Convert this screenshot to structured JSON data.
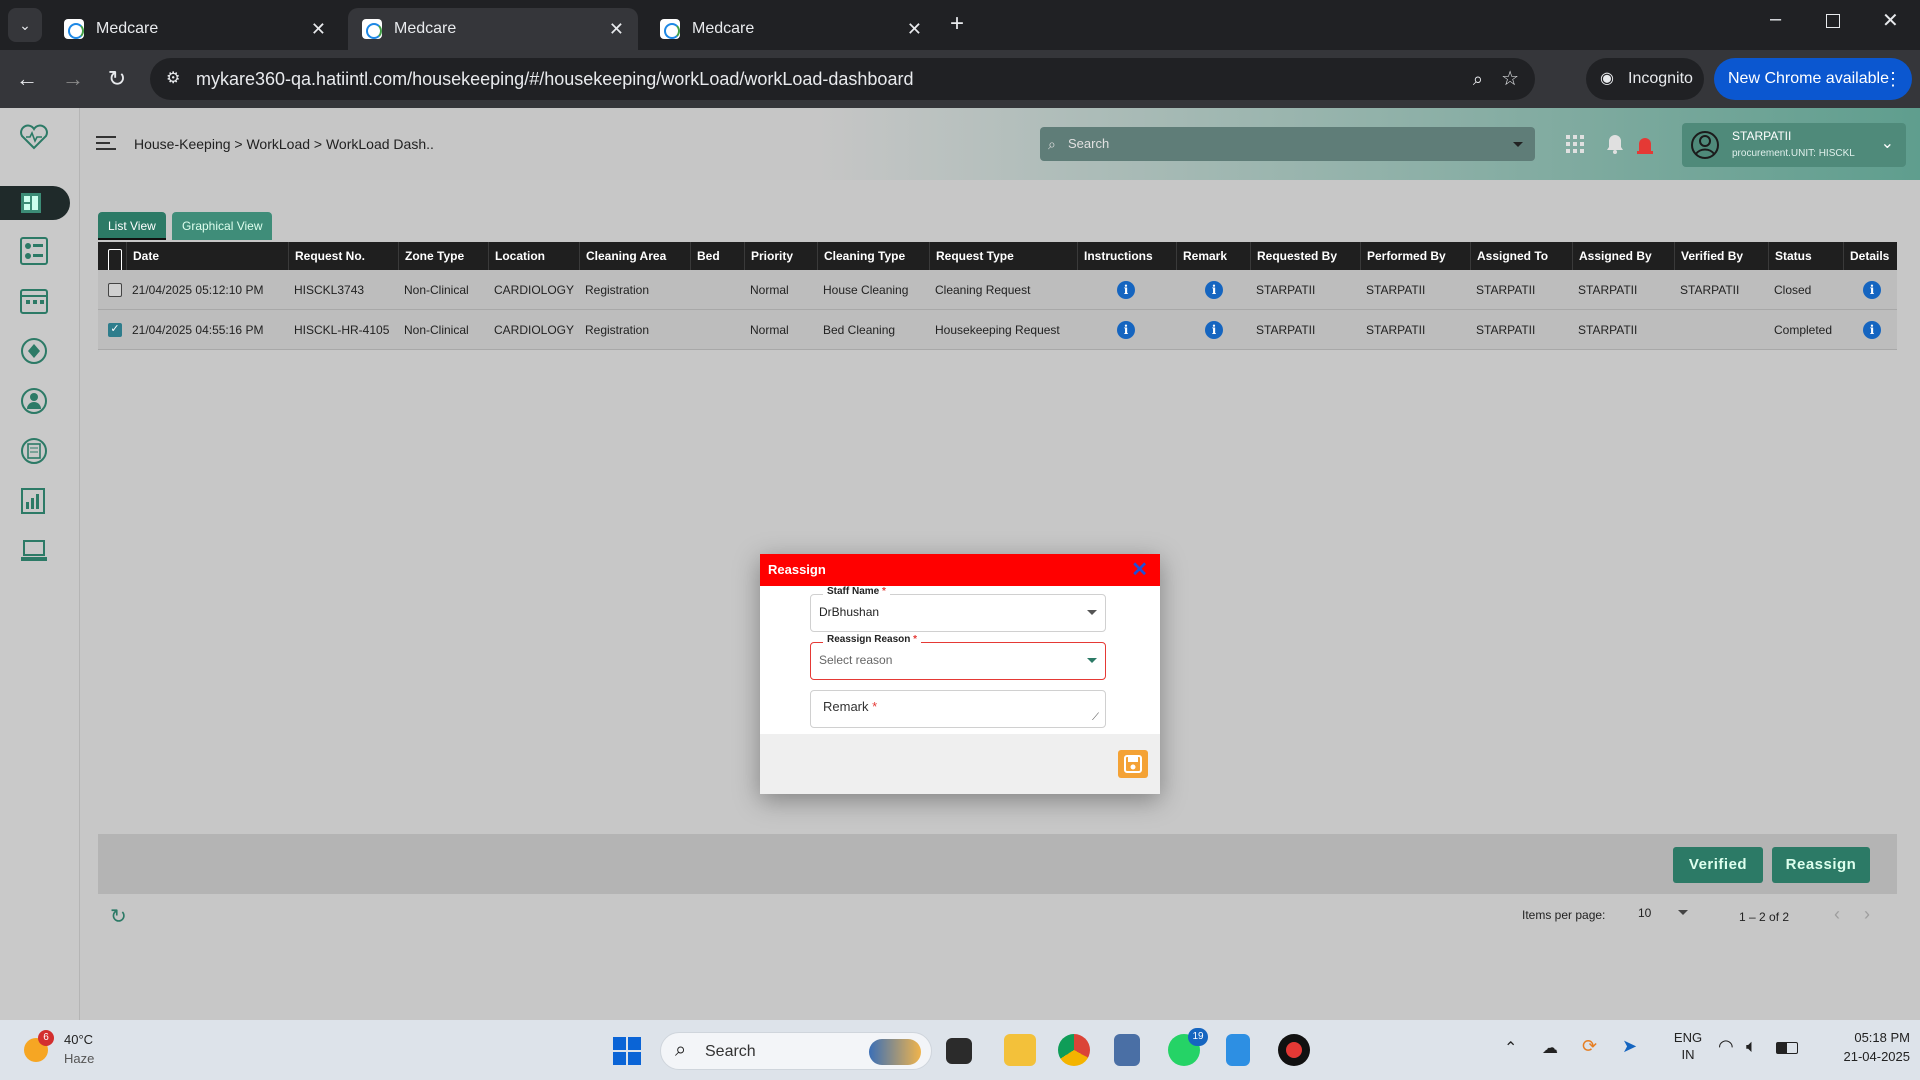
{
  "browser": {
    "tabs": [
      {
        "title": "Medcare"
      },
      {
        "title": "Medcare"
      },
      {
        "title": "Medcare"
      }
    ],
    "url": "mykare360-qa.hatiintl.com/housekeeping/#/housekeeping/workLoad/workLoad-dashboard",
    "incognito_label": "Incognito",
    "new_chrome_label": "New Chrome available"
  },
  "header": {
    "breadcrumb": "House-Keeping > WorkLoad > WorkLoad Dash..",
    "search_placeholder": "Search",
    "user_name": "STARPATII",
    "user_unit": "procurement.UNIT: HISCKL"
  },
  "view_tabs": {
    "list": "List View",
    "graphical": "Graphical View"
  },
  "table": {
    "columns": [
      "Date",
      "Request No.",
      "Zone Type",
      "Location",
      "Cleaning Area",
      "Bed",
      "Priority",
      "Cleaning Type",
      "Request Type",
      "Instructions",
      "Remark",
      "Requested By",
      "Performed By",
      "Assigned To",
      "Assigned By",
      "Verified By",
      "Status",
      "Details"
    ],
    "rows": [
      {
        "date": "21/04/2025 05:12:10 PM",
        "request_no": "HISCKL3743",
        "zone": "Non-Clinical",
        "location": "CARDIOLOGY",
        "area": "Registration",
        "bed": "",
        "priority": "Normal",
        "cleaning_type": "House Cleaning",
        "request_type": "Cleaning Request",
        "requested_by": "STARPATII",
        "performed_by": "STARPATII",
        "assigned_to": "STARPATII",
        "assigned_by": "STARPATII",
        "verified_by": "STARPATII",
        "status": "Closed",
        "checked": false
      },
      {
        "date": "21/04/2025 04:55:16 PM",
        "request_no": "HISCKL-HR-4105",
        "zone": "Non-Clinical",
        "location": "CARDIOLOGY",
        "area": "Registration",
        "bed": "",
        "priority": "Normal",
        "cleaning_type": "Bed Cleaning",
        "request_type": "Housekeeping Request",
        "requested_by": "STARPATII",
        "performed_by": "STARPATII",
        "assigned_to": "STARPATII",
        "assigned_by": "STARPATII",
        "verified_by": "",
        "status": "Completed",
        "checked": true
      }
    ]
  },
  "actions": {
    "verified": "Verified",
    "reassign": "Reassign"
  },
  "pagination": {
    "items_per_page_label": "Items per page:",
    "items_per_page": "10",
    "range": "1 – 2 of 2"
  },
  "modal": {
    "title": "Reassign",
    "staff_label": "Staff Name",
    "staff_value": "DrBhushan",
    "reason_label": "Reassign Reason",
    "reason_placeholder": "Select reason",
    "remark_label": "Remark",
    "required_mark": "*"
  },
  "taskbar": {
    "weather_temp": "40°C",
    "weather_desc": "Haze",
    "weather_badge": "6",
    "search_label": "Search",
    "whatsapp_badge": "19",
    "lang": "ENG",
    "region": "IN",
    "time": "05:18 PM",
    "date": "21-04-2025"
  },
  "colors": {
    "accent": "#2c7a66",
    "modal_header": "#ff0000",
    "info_icon": "#1565c0",
    "save": "#f4a235"
  }
}
